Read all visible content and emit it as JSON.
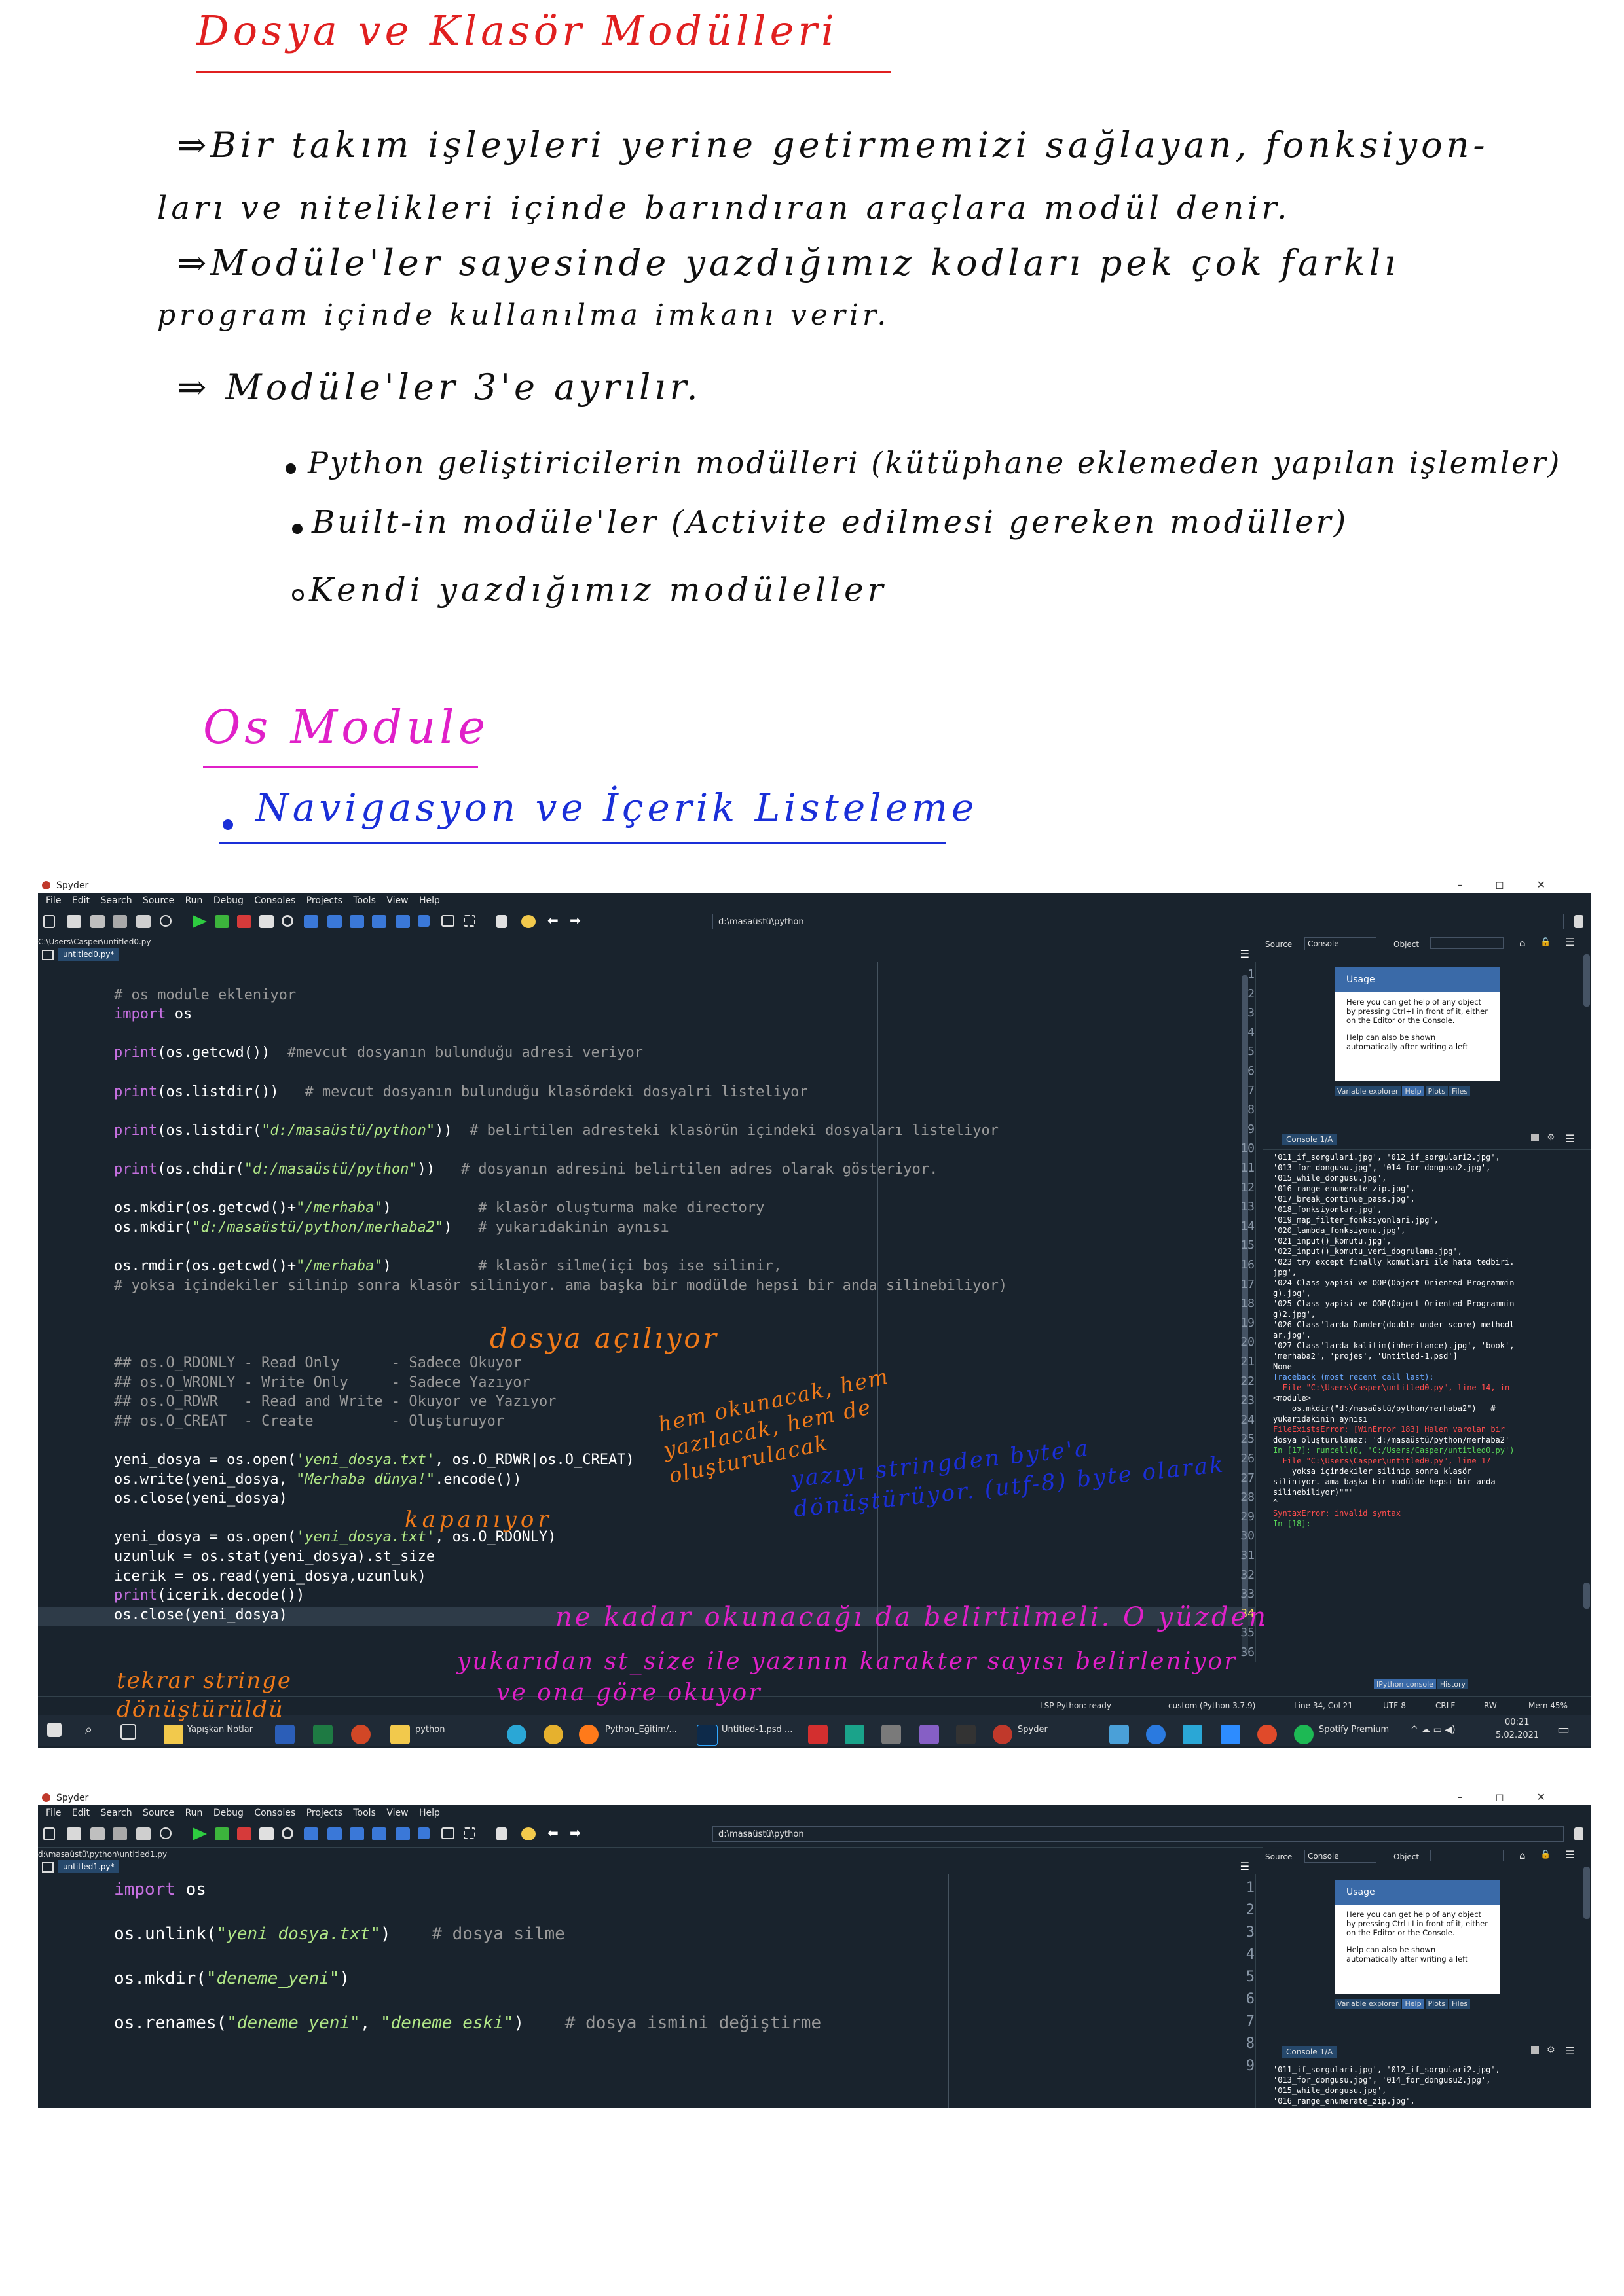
{
  "notes": {
    "title": "Dosya ve Klasör Modülleri",
    "p1_line1": "⇒Bir takım işleyleri yerine getirmemizi sağlayan, fonksiyon-",
    "p1_line2": "ları ve nitelikleri içinde barındıran araçlara modül denir.",
    "p2_line1": "⇒Modüle'ler sayesinde yazdığımız kodları pek çok farklı",
    "p2_line2": "program içinde kullanılma imkanı verir.",
    "p3": "⇒ Modüle'ler 3'e ayrılır.",
    "b1": "Python geliştiricilerin modülleri (kütüphane eklemeden yapılan işlemler)",
    "b2": "Built-in modüle'ler (Activite edilmesi gereken modüller)",
    "b3": "Kendi yazdığımız modüleller",
    "os_heading": "Os Module",
    "sub_heading": "Navigasyon ve İçerik Listeleme"
  },
  "colors": {
    "title": "#e02020",
    "pink": "#e020c8",
    "blue": "#1a2fd8",
    "orange": "#f07a1a",
    "editor_bg": "#19232d"
  },
  "win1": {
    "app_title": "Spyder",
    "menu": [
      "File",
      "Edit",
      "Search",
      "Source",
      "Run",
      "Debug",
      "Consoles",
      "Projects",
      "Tools",
      "View",
      "Help"
    ],
    "cwd": "d:\\masaüstü\\python",
    "file_path": "C:\\Users\\Casper\\untitled0.py",
    "tab_label": "untitled0.py*",
    "help_source_label": "Source",
    "help_source_value": "Console",
    "help_object_label": "Object",
    "help_title": "Usage",
    "help_text1": "Here you can get help of any object by pressing Ctrl+I in front of it, either on the Editor or the Console.",
    "help_text2": "Help can also be shown automatically after writing a left",
    "help_tabs": [
      "Variable explorer",
      "Help",
      "Plots",
      "Files"
    ],
    "console_tab": "Console 1/A",
    "console_tabs_bottom": [
      "IPython console",
      "History"
    ],
    "status": {
      "lsp": "LSP Python: ready",
      "env": "custom (Python 3.7.9)",
      "pos": "Line 34, Col 21",
      "enc": "UTF-8",
      "eol": "CRLF",
      "rw": "RW",
      "mem": "Mem 45%"
    },
    "taskbar": {
      "items": [
        "Yapışkan Notlar",
        "python",
        "Python_Eğitim/...",
        "Untitled-1.psd ...",
        "Spyder",
        "Spotify Premium"
      ],
      "time": "00:21",
      "date": "5.02.2021"
    }
  },
  "code1": [
    {
      "n": "1",
      "t": ""
    },
    {
      "n": "2",
      "t": "# os module ekleniyor"
    },
    {
      "n": "3",
      "t": "import os"
    },
    {
      "n": "4",
      "t": ""
    },
    {
      "n": "5",
      "t": "print(os.getcwd())  #mevcut dosyanın bulunduğu adresi veriyor"
    },
    {
      "n": "6",
      "t": ""
    },
    {
      "n": "7",
      "t": "print(os.listdir())   # mevcut dosyanın bulunduğu klasördeki dosyalri listeliyor"
    },
    {
      "n": "8",
      "t": ""
    },
    {
      "n": "9",
      "t": "print(os.listdir(\"d:/masaüstü/python\"))  # belirtilen adresteki klasörün içindeki dosyaları listeliyor"
    },
    {
      "n": "10",
      "t": ""
    },
    {
      "n": "11",
      "t": "print(os.chdir(\"d:/masaüstü/python\"))   # dosyanın adresini belirtilen adres olarak gösteriyor."
    },
    {
      "n": "12",
      "t": ""
    },
    {
      "n": "13",
      "t": "os.mkdir(os.getcwd()+\"/merhaba\")          # klasör oluşturma make directory"
    },
    {
      "n": "14",
      "t": "os.mkdir(\"d:/masaüstü/python/merhaba2\")   # yukarıdakinin aynısı"
    },
    {
      "n": "15",
      "t": ""
    },
    {
      "n": "16",
      "t": "os.rmdir(os.getcwd()+\"/merhaba\")          # klasör silme(içi boş ise silinir,"
    },
    {
      "n": "17",
      "t": "# yoksa içindekiler silinip sonra klasör siliniyor. ama başka bir modülde hepsi bir anda silinebiliyor)"
    },
    {
      "n": "18",
      "t": ""
    },
    {
      "n": "19",
      "t": ""
    },
    {
      "n": "20",
      "t": ""
    },
    {
      "n": "21",
      "t": "## os.O_RDONLY - Read Only      - Sadece Okuyor"
    },
    {
      "n": "22",
      "t": "## os.O_WRONLY - Write Only     - Sadece Yazıyor"
    },
    {
      "n": "23",
      "t": "## os.O_RDWR   - Read and Write - Okuyor ve Yazıyor"
    },
    {
      "n": "24",
      "t": "## os.O_CREAT  - Create         - Oluşturuyor"
    },
    {
      "n": "25",
      "t": ""
    },
    {
      "n": "26",
      "t": "yeni_dosya = os.open('yeni_dosya.txt', os.O_RDWR|os.O_CREAT)"
    },
    {
      "n": "27",
      "t": "os.write(yeni_dosya, \"Merhaba dünya!\".encode())"
    },
    {
      "n": "28",
      "t": "os.close(yeni_dosya)"
    },
    {
      "n": "29",
      "t": ""
    },
    {
      "n": "30",
      "t": "yeni_dosya = os.open('yeni_dosya.txt', os.O_RDONLY)"
    },
    {
      "n": "31",
      "t": "uzunluk = os.stat(yeni_dosya).st_size"
    },
    {
      "n": "32",
      "t": "icerik = os.read(yeni_dosya,uzunluk)"
    },
    {
      "n": "33",
      "t": "print(icerik.decode())"
    },
    {
      "n": "34",
      "t": "os.close(yeni_dosya)"
    },
    {
      "n": "35",
      "t": ""
    },
    {
      "n": "36",
      "t": ""
    }
  ],
  "console1": [
    "'011_if_sorgulari.jpg', '012_if_sorgulari2.jpg',",
    "'013_for_dongusu.jpg', '014_for_dongusu2.jpg',",
    "'015_while_dongusu.jpg',",
    "'016_range_enumerate_zip.jpg',",
    "'017_break_continue_pass.jpg',",
    "'018_fonksiyonlar.jpg',",
    "'019_map_filter_fonksiyonlari.jpg',",
    "'020_lambda_fonksiyonu.jpg',",
    "'021_input()_komutu.jpg',",
    "'022_input()_komutu_veri_dogrulama.jpg',",
    "'023_try_except_finally_komutlari_ile_hata_tedbiri.",
    "jpg',",
    "'024_Class_yapisi_ve_OOP(Object_Oriented_Programmin",
    "g).jpg',",
    "'025_Class_yapisi_ve_OOP(Object_Oriented_Programmin",
    "g)2.jpg',",
    "'026_Class'larda_Dunder(double_under_score)_methodl",
    "ar.jpg',",
    "'027_Class'larda_kalitim(inheritance).jpg', 'book',",
    "'merhaba2', 'projes', 'Untitled-1.psd']",
    "None",
    "Traceback (most recent call last):",
    "",
    "  File \"C:\\Users\\Casper\\untitled0.py\", line 14, in",
    "<module>",
    "    os.mkdir(\"d:/masaüstü/python/merhaba2\")   #",
    "yukarıdakinin aynısı",
    "",
    "FileExistsError: [WinError 183] Halen varolan bir",
    "dosya oluşturulamaz: 'd:/masaüstü/python/merhaba2'",
    "",
    "",
    "In [17]: runcell(0, 'C:/Users/Casper/untitled0.py')",
    "  File \"C:\\Users\\Casper\\untitled0.py\", line 17",
    "    yoksa içindekiler silinip sonra klasör",
    "siliniyor. ama başka bir modülde hepsi bir anda",
    "silinebiliyor)\"\"\"",
    "",
    "^",
    "SyntaxError: invalid syntax",
    "",
    "",
    "In [18]:"
  ],
  "annotations": {
    "a1": "dosya açılıyor",
    "a2": "hem okunacak, hem yazılacak, hem de oluşturulacak",
    "a3": "kapanıyor",
    "a4": "yazıyı stringden byte'a dönüştürüyor. (utf-8) byte olarak",
    "a5": "ne kadar okunacağı da belirtilmeli. O yüzden",
    "a6": "yukarıdan st_size ile yazının karakter sayısı belirleniyor",
    "a7": "ve ona göre okuyor",
    "a8": "tekrar stringe dönüştürüldü"
  },
  "win2": {
    "app_title": "Spyder",
    "cwd": "d:\\masaüstü\\python",
    "file_path": "d:\\masaüstü\\python\\untitled1.py",
    "tab_label": "untitled1.py*",
    "help_source_label": "Source",
    "help_source_value": "Console",
    "help_object_label": "Object",
    "help_title": "Usage",
    "help_text1": "Here you can get help of any object by pressing Ctrl+I in front of it, either on the Editor or the Console.",
    "help_text2": "Help can also be shown automatically after writing a left",
    "help_tabs": [
      "Variable explorer",
      "Help",
      "Plots",
      "Files"
    ],
    "console_tab": "Console 1/A"
  },
  "code2": [
    {
      "n": "1",
      "t": "import os"
    },
    {
      "n": "2",
      "t": ""
    },
    {
      "n": "3",
      "t": "os.unlink(\"yeni_dosya.txt\")    # dosya silme"
    },
    {
      "n": "4",
      "t": ""
    },
    {
      "n": "5",
      "t": "os.mkdir(\"deneme_yeni\")"
    },
    {
      "n": "6",
      "t": ""
    },
    {
      "n": "7",
      "t": "os.renames(\"deneme_yeni\", \"deneme_eski\")    # dosya ismini değiştirme"
    },
    {
      "n": "8",
      "t": ""
    },
    {
      "n": "9",
      "t": ""
    }
  ],
  "console2": [
    "'011_if_sorgulari.jpg', '012_if_sorgulari2.jpg',",
    "'013_for_dongusu.jpg', '014_for_dongusu2.jpg',",
    "'015_while_dongusu.jpg',",
    "'016_range_enumerate_zip.jpg',"
  ]
}
